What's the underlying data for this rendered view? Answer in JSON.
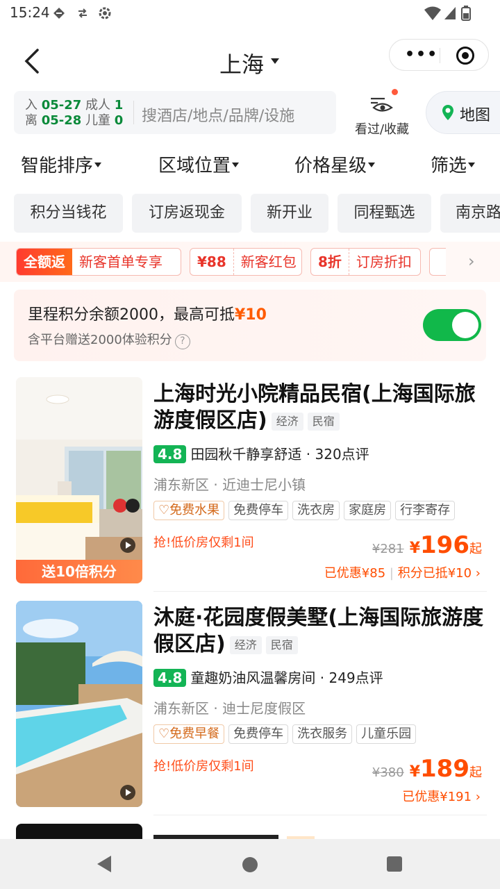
{
  "status_bar": {
    "time": "15:24"
  },
  "header": {
    "city": "上海"
  },
  "search": {
    "checkin_label": "入",
    "checkin_date": "05-27",
    "checkout_label": "离",
    "checkout_date": "05-28",
    "adults_label": "成人",
    "adults": "1",
    "children_label": "儿童",
    "children": "0",
    "placeholder": "搜酒店/地点/品牌/设施",
    "fav_label": "看过/收藏",
    "map_label": "地图"
  },
  "sort": [
    "智能排序",
    "区域位置",
    "价格星级",
    "筛选"
  ],
  "chips": [
    "积分当钱花",
    "订房返现金",
    "新开业",
    "同程甄选",
    "南京路"
  ],
  "promos": [
    {
      "tag": "全额返",
      "desc": "新客首单专享"
    },
    {
      "tag": "¥88",
      "desc": "新客红包"
    },
    {
      "tag": "8折",
      "desc": "订房折扣"
    }
  ],
  "points": {
    "text": "里程积分余额2000，最高可抵",
    "amount": "¥10",
    "sub": "含平台赠送2000体验积分",
    "help": "?",
    "enabled": true
  },
  "hotels": [
    {
      "name": "上海时光小院精品民宿(上海国际旅游度假区店)",
      "tags": [
        "经济",
        "民宿"
      ],
      "score": "4.8",
      "highlight": "田园秋千静享舒适",
      "reviews": "· 320点评",
      "location": "浦东新区 · 近迪士尼小镇",
      "amenities": [
        "免费水果",
        "免费停车",
        "洗衣房",
        "家庭房",
        "行李寄存"
      ],
      "low_stock": "抢!低价房仅剩1间",
      "old_price": "¥281",
      "currency": "¥",
      "price": "196",
      "price_suffix": "起",
      "saved": "已优惠¥85",
      "points_note": "积分已抵¥10",
      "thumb_tag": "送10倍积分"
    },
    {
      "name": "沐庭·花园度假美墅(上海国际旅游度假区店)",
      "tags": [
        "经济",
        "民宿"
      ],
      "score": "4.8",
      "highlight": "童趣奶油风温馨房间",
      "reviews": "· 249点评",
      "location": "浦东新区 · 迪士尼度假区",
      "amenities": [
        "免费早餐",
        "免费停车",
        "洗衣服务",
        "儿童乐园"
      ],
      "low_stock": "抢!低价房仅剩1间",
      "old_price": "¥380",
      "currency": "¥",
      "price": "189",
      "price_suffix": "起",
      "saved": "已优惠¥191"
    }
  ],
  "colors": {
    "accent_green": "#13b455",
    "price_orange": "#ff4d00",
    "promo_red": "#e8342a"
  }
}
